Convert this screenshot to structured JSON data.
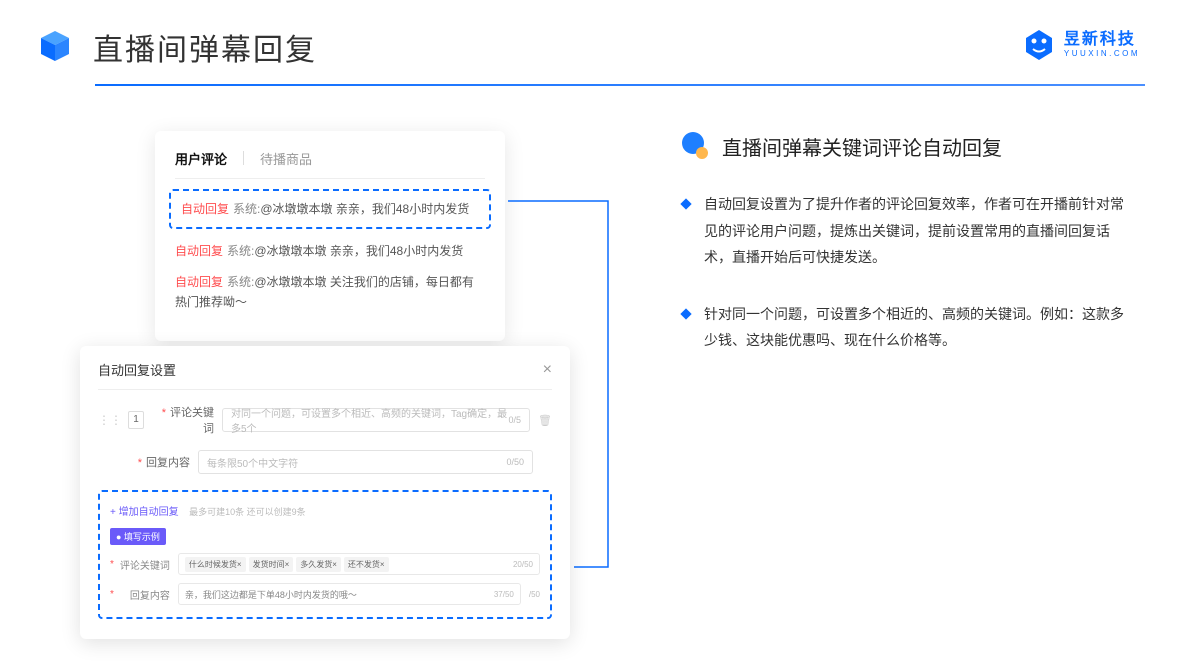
{
  "header": {
    "title": "直播间弹幕回复"
  },
  "brand": {
    "cn": "昱新科技",
    "en": "YUUXIN.COM"
  },
  "panel1": {
    "tab1": "用户评论",
    "tab2": "待播商品",
    "c1_auto": "自动回复",
    "c1_sys": "系统:",
    "c1_txt": "@冰墩墩本墩 亲亲，我们48小时内发货",
    "c2_auto": "自动回复",
    "c2_sys": "系统:",
    "c2_txt": "@冰墩墩本墩 亲亲，我们48小时内发货",
    "c3_auto": "自动回复",
    "c3_sys": "系统:",
    "c3_txt": "@冰墩墩本墩 关注我们的店铺，每日都有热门推荐呦～"
  },
  "panel2": {
    "title": "自动回复设置",
    "close": "×",
    "num": "1",
    "lbl1": "评论关键词",
    "ph1": "对同一个问题，可设置多个相近、高频的关键词，Tag确定，最多5个",
    "cnt1": "0/5",
    "lbl2": "回复内容",
    "ph2": "每条限50个中文字符",
    "cnt2": "0/50",
    "addlink": "+ 增加自动回复",
    "addhint": "最多可建10条 还可以创建9条",
    "badge": "● 填写示例",
    "sublbl1": "评论关键词",
    "tag1": "什么时候发货×",
    "tag2": "发货时间×",
    "tag3": "多久发货×",
    "tag4": "还不发货×",
    "tcnt1": "20/50",
    "sublbl2": "回复内容",
    "subtxt": "亲，我们这边都是下单48小时内发货的哦～",
    "tcnt2": "37/50",
    "outcnt": "/50"
  },
  "right": {
    "title": "直播间弹幕关键词评论自动回复",
    "b1": "自动回复设置为了提升作者的评论回复效率，作者可在开播前针对常见的评论用户问题，提炼出关键词，提前设置常用的直播间回复话术，直播开始后可快捷发送。",
    "b2": "针对同一个问题，可设置多个相近的、高频的关键词。例如：这款多少钱、这块能优惠吗、现在什么价格等。"
  }
}
